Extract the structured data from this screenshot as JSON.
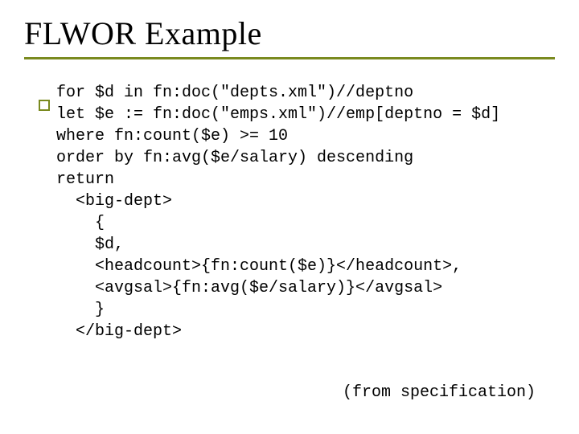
{
  "title": "FLWOR Example",
  "code_lines": [
    "for $d in fn:doc(\"depts.xml\")//deptno",
    "let $e := fn:doc(\"emps.xml\")//emp[deptno = $d]",
    "where fn:count($e) >= 10",
    "order by fn:avg($e/salary) descending",
    "return",
    "  <big-dept>",
    "    {",
    "    $d,",
    "    <headcount>{fn:count($e)}</headcount>,",
    "    <avgsal>{fn:avg($e/salary)}</avgsal>",
    "    }",
    "  </big-dept>"
  ],
  "footnote": "(from specification)"
}
